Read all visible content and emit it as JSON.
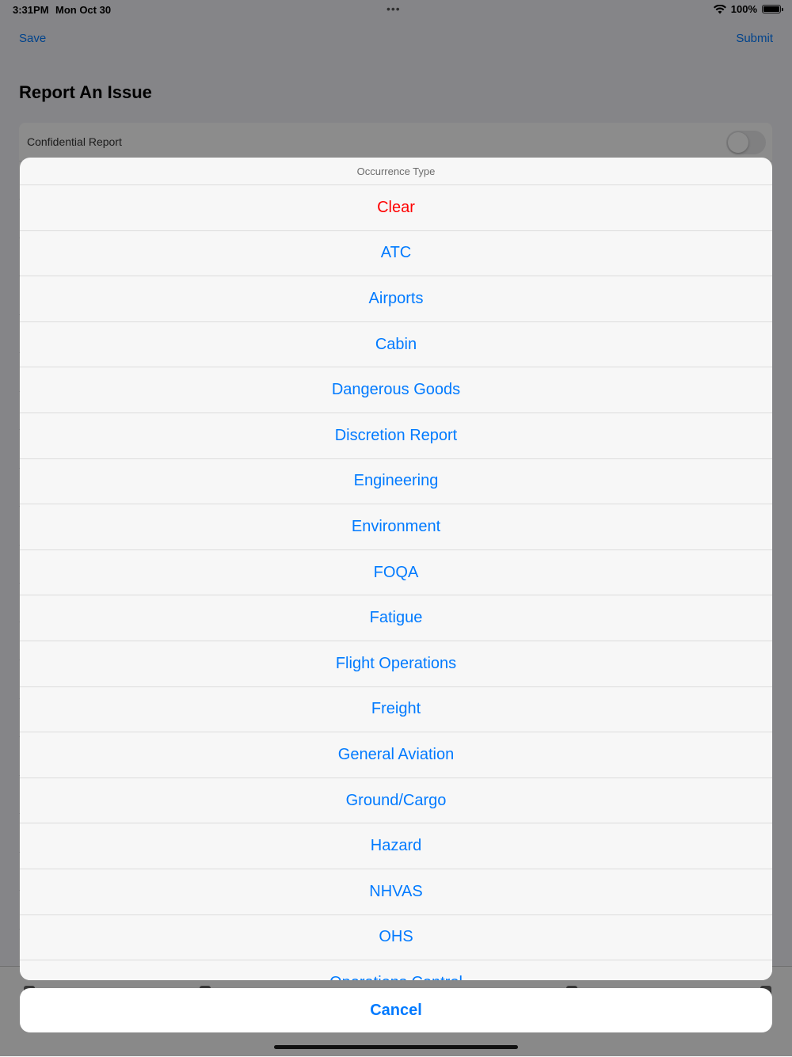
{
  "status_bar": {
    "time": "3:31PM",
    "date": "Mon Oct 30",
    "dots": "•••",
    "battery": "100%"
  },
  "nav": {
    "save_label": "Save",
    "submit_label": "Submit",
    "title": "Report An Issue"
  },
  "form": {
    "confidential_label": "Confidential Report",
    "rows": [
      {
        "label": "",
        "value": ""
      },
      {
        "label": "",
        "value": ""
      },
      {
        "label": "",
        "value": ""
      },
      {
        "label": "",
        "value": ""
      },
      {
        "label": "",
        "value": ""
      },
      {
        "label": "",
        "value": ""
      },
      {
        "label": "",
        "value": ""
      },
      {
        "label": "",
        "value": ""
      },
      {
        "label": "",
        "value": ""
      },
      {
        "label": "",
        "value": ""
      },
      {
        "label": "",
        "value": ""
      },
      {
        "label": "",
        "value": ""
      },
      {
        "label": "",
        "value": ""
      },
      {
        "label": "",
        "value": ""
      },
      {
        "label": "",
        "value": ""
      },
      {
        "label": "",
        "value": ""
      },
      {
        "label": "",
        "value": ""
      },
      {
        "label": "",
        "value": ""
      },
      {
        "label": "",
        "value": ""
      },
      {
        "label": "",
        "value": ""
      },
      {
        "label": "",
        "value": ""
      },
      {
        "label": "",
        "value": ""
      }
    ]
  },
  "action_sheet": {
    "title": "Occurrence Type",
    "options": [
      "Clear",
      "ATC",
      "Airports",
      "Cabin",
      "Dangerous Goods",
      "Discretion Report",
      "Engineering",
      "Environment",
      "FOQA",
      "Fatigue",
      "Flight Operations",
      "Freight",
      "General Aviation",
      "Ground/Cargo",
      "Hazard",
      "NHVAS",
      "OHS",
      "Operations Control"
    ],
    "cancel_label": "Cancel"
  },
  "colors": {
    "accent": "#007aff",
    "destructive": "#ff0000"
  }
}
